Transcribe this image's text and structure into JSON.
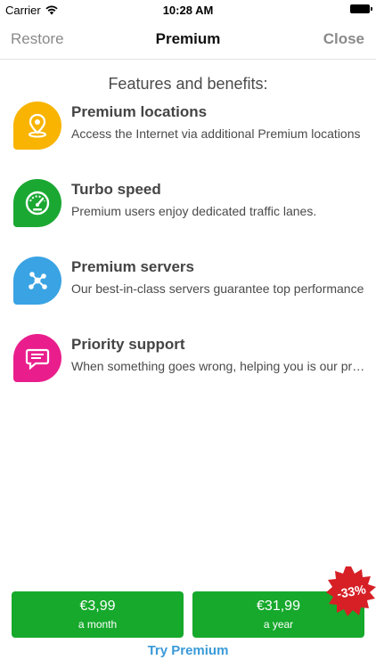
{
  "status_bar": {
    "carrier": "Carrier",
    "time": "10:28 AM"
  },
  "nav": {
    "left": "Restore",
    "title": "Premium",
    "right": "Close"
  },
  "section_title": "Features and benefits:",
  "features": [
    {
      "title": "Premium locations",
      "desc": "Access the Internet via additional Premium locations",
      "icon": "location-pin-icon",
      "color": "#f8b400"
    },
    {
      "title": "Turbo speed",
      "desc": "Premium users enjoy dedicated traffic lanes.",
      "icon": "speedometer-icon",
      "color": "#1aa832"
    },
    {
      "title": "Premium servers",
      "desc": "Our best-in-class servers guarantee top performance",
      "icon": "network-nodes-icon",
      "color": "#3aa3e3"
    },
    {
      "title": "Priority support",
      "desc": "When something goes wrong, helping you is our priority",
      "icon": "chat-bubble-icon",
      "color": "#e91e8c"
    }
  ],
  "plans": [
    {
      "price": "€3,99",
      "period": "a month"
    },
    {
      "price": "€31,99",
      "period": "a year"
    }
  ],
  "discount_badge": "-33%",
  "try_label": "Try Premium",
  "colors": {
    "plan_green": "#16a92c",
    "badge_red": "#d62026",
    "link_blue": "#3a9ad9"
  }
}
